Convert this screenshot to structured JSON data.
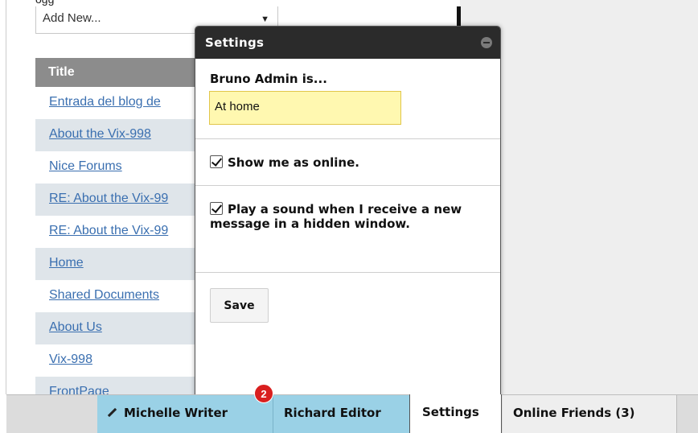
{
  "top_caption": "ogg",
  "add_new": {
    "value": "Add New...",
    "arrow": "▼"
  },
  "list": {
    "header": "Title",
    "rows": [
      "Entrada del blog de",
      "About the Vix-998",
      "Nice Forums",
      "RE: About the Vix-99",
      "RE: About the Vix-99",
      "Home",
      "Shared Documents",
      "About Us",
      "Vix-998",
      "FrontPage"
    ]
  },
  "dialog": {
    "title": "Settings",
    "status_label": "Bruno Admin is...",
    "status_value": "At home",
    "show_online_label": "Show me as online.",
    "show_online_checked": true,
    "sound_label": "Play a sound when I receive a new message in a hidden window.",
    "sound_checked": true,
    "save_label": "Save"
  },
  "taskbar": {
    "tabs": [
      {
        "label": "Michelle Writer",
        "icon": "pencil-icon"
      },
      {
        "label": "Richard Editor"
      },
      {
        "label": "Settings",
        "active": true
      },
      {
        "label": "Online Friends (3)"
      }
    ],
    "notification_count": "2"
  },
  "colors": {
    "dialog_header": "#2b2b2b",
    "status_input_bg": "#fff8b0",
    "tab_blue": "#9ad1e6",
    "badge_red": "#d91f1f",
    "link_blue": "#3a6fb0"
  }
}
